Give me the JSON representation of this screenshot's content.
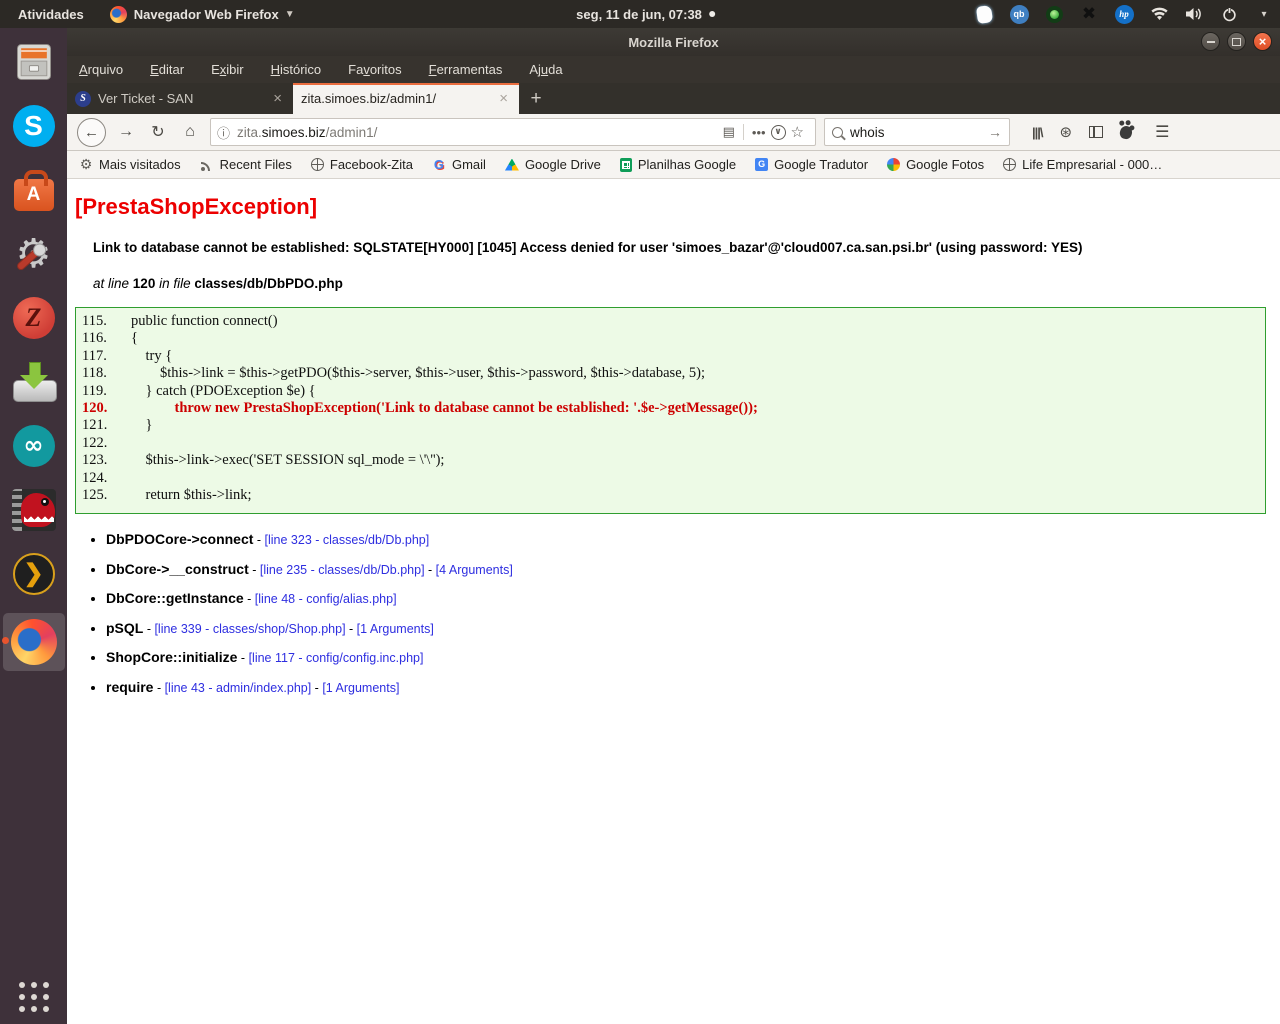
{
  "topbar": {
    "activities": "Atividades",
    "app_menu": "Navegador Web Firefox",
    "clock": "seg, 11 de jun, 07:38",
    "tray_icons": [
      "notes",
      "qbittorrent",
      "status-green",
      "x-app",
      "hp",
      "wifi",
      "volume",
      "power",
      "chevron-down"
    ]
  },
  "dock": {
    "items": [
      "file-cabinet",
      "skype",
      "software-center",
      "system-settings",
      "red-script-app",
      "downloads",
      "arduino",
      "video-editor",
      "plex",
      "firefox"
    ],
    "active_item": "firefox",
    "show_apps": "show-applications"
  },
  "window": {
    "title": "Mozilla Firefox",
    "menus": [
      {
        "label": "Arquivo",
        "accel": 0
      },
      {
        "label": "Editar",
        "accel": 0
      },
      {
        "label": "Exibir",
        "accel": 1
      },
      {
        "label": "Histórico",
        "accel": 0
      },
      {
        "label": "Favoritos",
        "accel": 2
      },
      {
        "label": "Ferramentas",
        "accel": 0
      },
      {
        "label": "Ajuda",
        "accel": 2
      }
    ],
    "tabs": [
      {
        "title": "Ver Ticket - SAN",
        "favicon": "osticket",
        "active": false
      },
      {
        "title": "zita.simoes.biz/admin1/",
        "favicon": null,
        "active": true
      }
    ],
    "new_tab_label": "+",
    "tab_close_glyph": "×"
  },
  "navbar": {
    "url": {
      "full": "zita.simoes.biz/admin1/",
      "pre": "zita.",
      "host": "simoes.biz",
      "path": "/admin1/"
    },
    "search": {
      "value": "whois"
    }
  },
  "bookmarks": [
    {
      "label": "Mais visitados",
      "icon": "gear"
    },
    {
      "label": "Recent Files",
      "icon": "rss"
    },
    {
      "label": "Facebook-Zita",
      "icon": "globe"
    },
    {
      "label": "Gmail",
      "icon": "google-g"
    },
    {
      "label": "Google Drive",
      "icon": "drive"
    },
    {
      "label": "Planilhas Google",
      "icon": "sheets"
    },
    {
      "label": "Google Tradutor",
      "icon": "translate"
    },
    {
      "label": "Google Fotos",
      "icon": "photos"
    },
    {
      "label": "Life Empresarial - 000…",
      "icon": "globe"
    }
  ],
  "page": {
    "heading": "[PrestaShopException]",
    "message": "Link to database cannot be established: SQLSTATE[HY000] [1045] Access denied for user 'simoes_bazar'@'cloud007.ca.san.psi.br' (using password: YES)",
    "at_line_label": "at line",
    "line_no": "120",
    "in_file_label": "in file",
    "file": "classes/db/DbPDO.php",
    "code": [
      {
        "n": "115.",
        "c": "public function connect()"
      },
      {
        "n": "116.",
        "c": "{"
      },
      {
        "n": "117.",
        "c": "    try {"
      },
      {
        "n": "118.",
        "c": "        $this->link = $this->getPDO($this->server, $this->user, $this->password, $this->database, 5);"
      },
      {
        "n": "119.",
        "c": "    } catch (PDOException $e) {"
      },
      {
        "n": "120.",
        "c": "            throw new PrestaShopException('Link to database cannot be established: '.$e->getMessage());",
        "hl": true
      },
      {
        "n": "121.",
        "c": "    }"
      },
      {
        "n": "122.",
        "c": ""
      },
      {
        "n": "123.",
        "c": "    $this->link->exec('SET SESSION sql_mode = \\'\\'');"
      },
      {
        "n": "124.",
        "c": ""
      },
      {
        "n": "125.",
        "c": "    return $this->link;"
      }
    ],
    "stack": [
      {
        "name": "DbPDOCore->connect",
        "links": [
          "[line 323 - classes/db/Db.php]"
        ]
      },
      {
        "name": "DbCore->__construct",
        "links": [
          "[line 235 - classes/db/Db.php]",
          "[4 Arguments]"
        ]
      },
      {
        "name": "DbCore::getInstance",
        "links": [
          "[line 48 - config/alias.php]"
        ]
      },
      {
        "name": "pSQL",
        "links": [
          "[line 339 - classes/shop/Shop.php]",
          "[1 Arguments]"
        ]
      },
      {
        "name": "ShopCore::initialize",
        "links": [
          "[line 117 - config/config.inc.php]"
        ]
      },
      {
        "name": "require",
        "links": [
          "[line 43 - admin/index.php]",
          "[1 Arguments]"
        ]
      }
    ]
  },
  "colors": {
    "error_red": "#ec0000",
    "highlight_line_red": "#cc0000",
    "code_bg": "#edfae6",
    "code_border": "#2f9e2f",
    "link_blue": "#2e2ee0",
    "tab_accent_orange": "#ea6d3f",
    "close_button_orange": "#de4f26",
    "topbar_bg": "#2c2925",
    "dock_bg": "#3e313a",
    "toolbar_bg": "#f5f3f0"
  }
}
